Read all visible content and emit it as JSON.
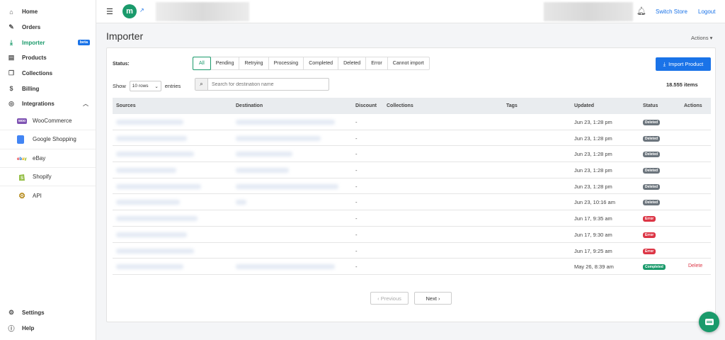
{
  "sidebar": {
    "items": [
      {
        "label": "Home",
        "icon": "home-icon"
      },
      {
        "label": "Orders",
        "icon": "edit-icon"
      },
      {
        "label": "Importer",
        "icon": "download-icon",
        "badge": "beta"
      },
      {
        "label": "Products",
        "icon": "products-icon"
      },
      {
        "label": "Collections",
        "icon": "box-icon"
      },
      {
        "label": "Billing",
        "icon": "dollar-icon"
      },
      {
        "label": "Integrations",
        "icon": "plug-icon"
      }
    ],
    "integrations": [
      {
        "label": "WooCommerce",
        "logo": "woocommerce-logo"
      },
      {
        "label": "Google Shopping",
        "logo": "google-shopping-logo"
      },
      {
        "label": "eBay",
        "logo": "ebay-logo"
      },
      {
        "label": "Shopify",
        "logo": "shopify-logo"
      },
      {
        "label": "API",
        "logo": "api-logo"
      }
    ],
    "bottom": [
      {
        "label": "Settings",
        "icon": "gear-icon"
      },
      {
        "label": "Help",
        "icon": "help-icon"
      }
    ]
  },
  "topbar": {
    "switch_store": "Switch Store",
    "logout": "Logout",
    "brand_letter": "m"
  },
  "page": {
    "title": "Importer",
    "actions": "Actions ▾"
  },
  "filters": {
    "label": "Status:",
    "items": [
      "All",
      "Pending",
      "Retrying",
      "Processing",
      "Completed",
      "Deleted",
      "Error",
      "Cannot import"
    ],
    "active": "All"
  },
  "import_button": "Import Product",
  "show": {
    "prefix": "Show",
    "rows": "10 rows",
    "suffix": "entries"
  },
  "search": {
    "placeholder": "Search for destination name"
  },
  "items_count": "18.555 items",
  "table": {
    "headers": [
      "Sources",
      "Destination",
      "Discount",
      "Collections",
      "Tags",
      "Updated",
      "Status",
      "Actions"
    ],
    "rows": [
      {
        "discount": "-",
        "updated": "Jun 23, 1:28 pm",
        "status": "Deleted",
        "action": ""
      },
      {
        "discount": "-",
        "updated": "Jun 23, 1:28 pm",
        "status": "Deleted",
        "action": ""
      },
      {
        "discount": "-",
        "updated": "Jun 23, 1:28 pm",
        "status": "Deleted",
        "action": ""
      },
      {
        "discount": "-",
        "updated": "Jun 23, 1:28 pm",
        "status": "Deleted",
        "action": ""
      },
      {
        "discount": "-",
        "updated": "Jun 23, 1:28 pm",
        "status": "Deleted",
        "action": ""
      },
      {
        "discount": "-",
        "updated": "Jun 23, 10:16 am",
        "status": "Deleted",
        "action": ""
      },
      {
        "discount": "-",
        "updated": "Jun 17, 9:35 am",
        "status": "Error",
        "action": ""
      },
      {
        "discount": "-",
        "updated": "Jun 17, 9:30 am",
        "status": "Error",
        "action": ""
      },
      {
        "discount": "-",
        "updated": "Jun 17, 9:25 am",
        "status": "Error",
        "action": ""
      },
      {
        "discount": "-",
        "updated": "May 26, 8:39 am",
        "status": "Completed",
        "action": "Delete"
      }
    ]
  },
  "pager": {
    "prev": "‹ Previous",
    "next": "Next ›"
  },
  "colors": {
    "accent": "#1a9a6b",
    "primary": "#1a73e8",
    "deleted": "#6c757d",
    "error": "#dc3545",
    "completed": "#1a9a6b"
  }
}
